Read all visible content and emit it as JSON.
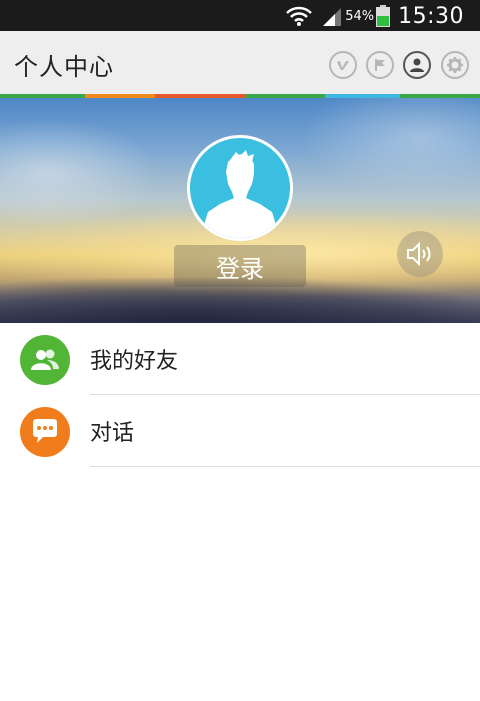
{
  "status_bar": {
    "battery_percent": "54%",
    "time": "15:30",
    "icons": [
      "wifi-icon",
      "signal-icon",
      "battery-icon"
    ]
  },
  "header": {
    "title": "个人中心",
    "icons": [
      "vimeo-icon",
      "flag-icon",
      "user-icon",
      "gear-icon"
    ]
  },
  "profile": {
    "login_label": "登录",
    "avatar_color": "#3bbfe0"
  },
  "list": {
    "items": [
      {
        "label": "我的好友",
        "icon": "friends-icon",
        "color": "#52b535"
      },
      {
        "label": "对话",
        "icon": "chat-icon",
        "color": "#f07c1c"
      }
    ]
  },
  "colors": {
    "strip": [
      "#3aa64a",
      "#f08a1c",
      "#e85a2a",
      "#3aa64a",
      "#3db8e0",
      "#3aa64a"
    ]
  }
}
